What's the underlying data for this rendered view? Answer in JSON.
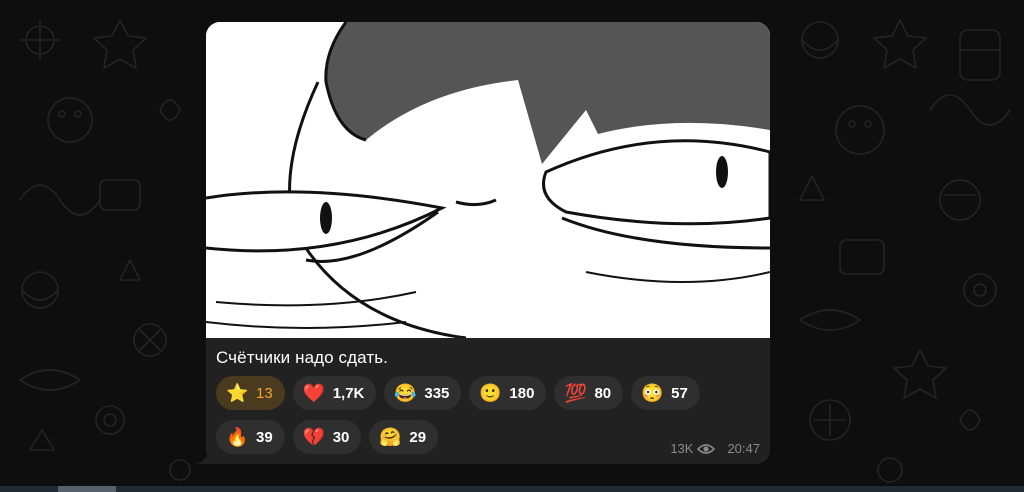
{
  "message": {
    "caption": "Счётчики надо сдать.",
    "photo_icon": "cartoon-face-sticker",
    "reactions_row1": [
      {
        "emoji": "⭐",
        "count": "13",
        "icon": "star-icon",
        "paid": true
      },
      {
        "emoji": "❤️",
        "count": "1,7K",
        "icon": "heart-icon"
      },
      {
        "emoji": "😂",
        "count": "335",
        "icon": "tears-of-joy-icon"
      },
      {
        "emoji": "🙂",
        "count": "180",
        "icon": "slight-smile-icon"
      },
      {
        "emoji": "💯",
        "count": "80",
        "icon": "hundred-points-icon"
      },
      {
        "emoji": "😳",
        "count": "57",
        "icon": "flushed-face-icon"
      }
    ],
    "reactions_row2": [
      {
        "emoji": "🔥",
        "count": "39",
        "icon": "fire-icon"
      },
      {
        "emoji": "💔",
        "count": "30",
        "icon": "broken-heart-icon"
      },
      {
        "emoji": "🤗",
        "count": "29",
        "icon": "hugging-face-icon"
      }
    ],
    "views": "13K",
    "time": "20:47"
  },
  "colors": {
    "background": "#0e0e0e",
    "bubble": "#212121",
    "reaction_bg": "#2f2f2f",
    "paid_reaction_bg": "#4a3a1e",
    "paid_accent": "#f2a531",
    "meta_text": "#8a8a8a"
  }
}
